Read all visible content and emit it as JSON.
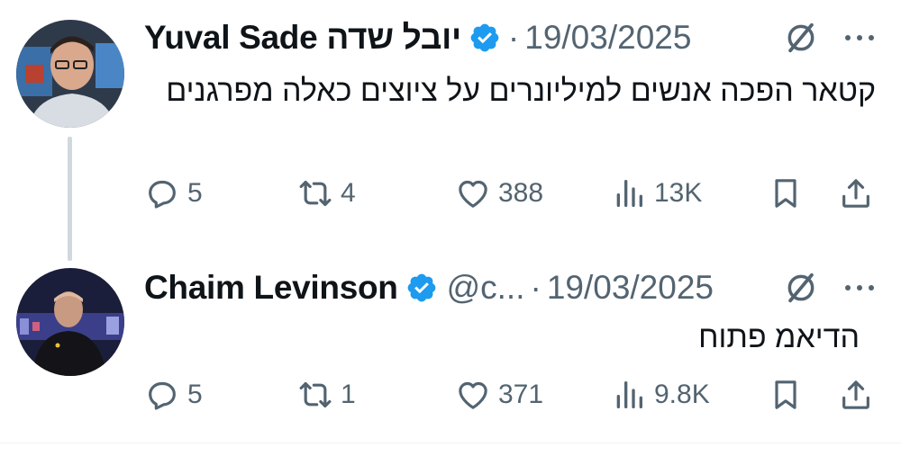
{
  "tweets": [
    {
      "author_name": "Yuval Sade יובל שדה",
      "handle": "",
      "separator": "·",
      "date": "19/03/2025",
      "text": "קטאר הפכה אנשים למיליונרים על ציוצים כאלה מפרגנים",
      "replies": "5",
      "retweets": "4",
      "likes": "388",
      "views": "13K"
    },
    {
      "author_name": "Chaim Levinson",
      "handle": "@c...",
      "separator": "·",
      "date": "19/03/2025",
      "text": "הדיאמ פתוח",
      "replies": "5",
      "retweets": "1",
      "likes": "371",
      "views": "9.8K"
    }
  ],
  "icons": {
    "verified": "verified-badge-icon",
    "grok": "grok-icon",
    "more": "more-options-icon",
    "reply": "reply-icon",
    "retweet": "retweet-icon",
    "like": "like-icon",
    "views": "views-icon",
    "bookmark": "bookmark-icon",
    "share": "share-icon"
  },
  "colors": {
    "verified_blue": "#1d9bf0",
    "secondary_text": "#536471",
    "thread_line": "#cfd9de"
  }
}
